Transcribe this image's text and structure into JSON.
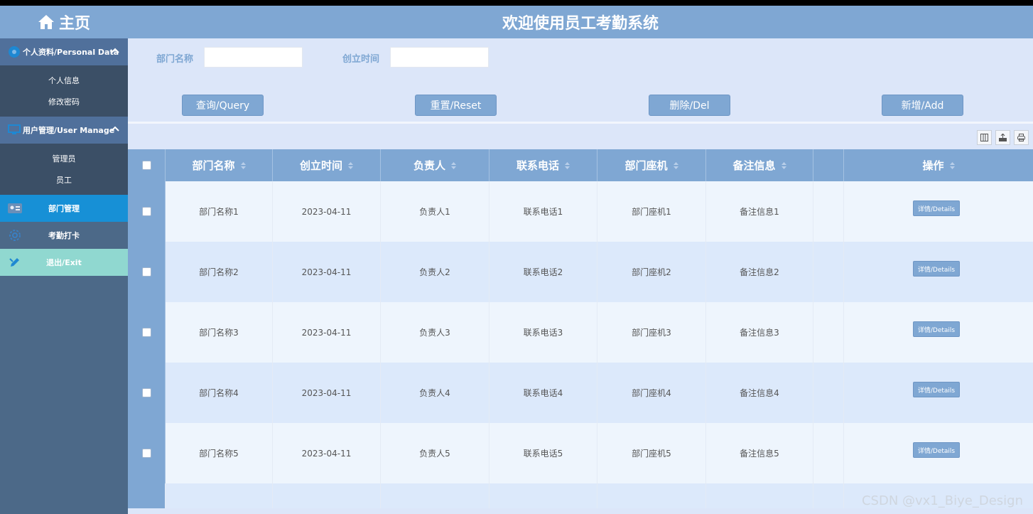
{
  "sidebar": {
    "home_label": "主页",
    "sections": [
      {
        "title": "个人资料/Personal Data",
        "items": [
          "个人信息",
          "修改密码"
        ]
      },
      {
        "title": "用户管理/User Manage",
        "items": [
          "管理员",
          "员工"
        ]
      }
    ],
    "nav": [
      {
        "label": "部门管理",
        "active": true
      },
      {
        "label": "考勤打卡"
      },
      {
        "label": "退出/Exit"
      }
    ]
  },
  "header": {
    "title": "欢迎使用员工考勤系统"
  },
  "filters": {
    "dept_name_label": "部门名称",
    "dept_name_value": "",
    "created_time_label": "创立时间",
    "created_time_value": ""
  },
  "actions": {
    "query": "查询/Query",
    "reset": "重置/Reset",
    "delete": "删除/Del",
    "add": "新增/Add"
  },
  "table": {
    "columns": [
      "部门名称",
      "创立时间",
      "负责人",
      "联系电话",
      "部门座机",
      "备注信息",
      "",
      "操作"
    ],
    "rows": [
      [
        "部门名称1",
        "2023-04-11",
        "负责人1",
        "联系电话1",
        "部门座机1",
        "备注信息1"
      ],
      [
        "部门名称2",
        "2023-04-11",
        "负责人2",
        "联系电话2",
        "部门座机2",
        "备注信息2"
      ],
      [
        "部门名称3",
        "2023-04-11",
        "负责人3",
        "联系电话3",
        "部门座机3",
        "备注信息3"
      ],
      [
        "部门名称4",
        "2023-04-11",
        "负责人4",
        "联系电话4",
        "部门座机4",
        "备注信息4"
      ],
      [
        "部门名称5",
        "2023-04-11",
        "负责人5",
        "联系电话5",
        "部门座机5",
        "备注信息5"
      ]
    ],
    "detail_label": "详情/Details"
  },
  "watermark": "CSDN @vx1_Biye_Design",
  "colors": {
    "accent": "#7fa7d3",
    "sidebar": "#4c6988",
    "active_nav": "#1790d6",
    "exit_nav": "#90d8d0"
  }
}
